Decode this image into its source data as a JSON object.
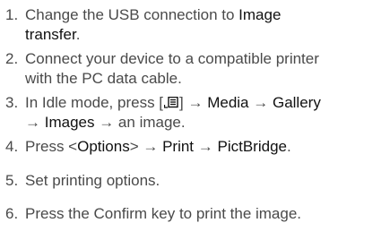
{
  "steps": [
    {
      "num": "1.",
      "l1_a": "Change the USB connection to ",
      "l1_b": "Image",
      "l2_b": "transfer",
      "l2_a": "."
    },
    {
      "num": "2.",
      "l1": "Connect your device to a compatible printer",
      "l2": "with the PC data cable."
    },
    {
      "num": "3.",
      "l1_a": "In Idle mode, press [",
      "l1_icon": "menu-key-icon",
      "l1_b": "] → ",
      "l1_c": "Media",
      "l1_d": " → ",
      "l1_e": "Gallery",
      "l2_a": "→ ",
      "l2_b": "Images",
      "l2_c": " → an image."
    },
    {
      "num": "4.",
      "a": "Press <",
      "b": "Options",
      "c": "> → ",
      "d": "Print",
      "e": " → ",
      "f": "PictBridge",
      "g": "."
    },
    {
      "num": "5.",
      "l1": "Set printing options."
    },
    {
      "num": "6.",
      "l1": "Press the Confirm key to print the image."
    }
  ]
}
